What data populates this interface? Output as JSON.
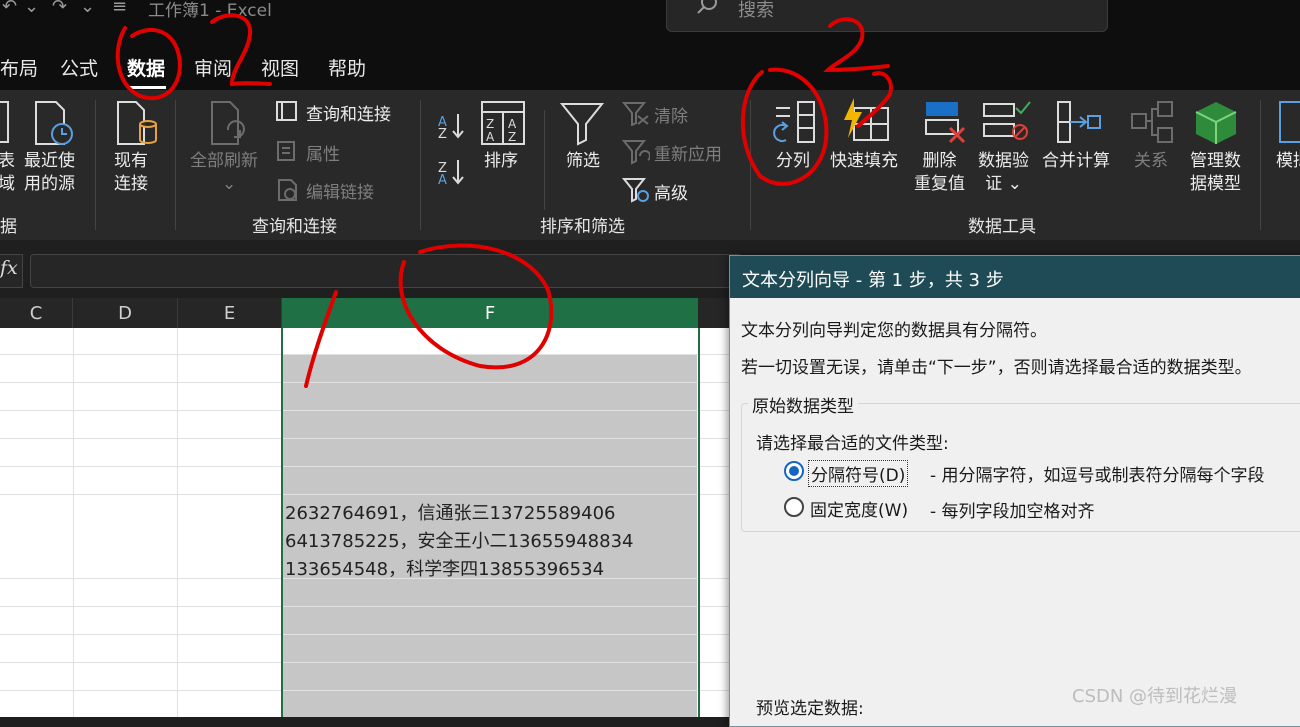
{
  "titlebar": {
    "qa_undo": "↶",
    "qa_chevron": "⌄",
    "qa_redo": "↷",
    "qa_customize": "≡",
    "doc_title": "工作簿1  -  Excel",
    "search_placeholder": "搜索"
  },
  "tabs": [
    "布局",
    "公式",
    "数据",
    "审阅",
    "视图",
    "帮助"
  ],
  "active_tab": "数据",
  "ribbon": {
    "get_data": {
      "from_table_partial": "表\n域",
      "recent_sources": "最近使\n用的源",
      "existing_connections": "现有\n连接",
      "group_label_partial": "据"
    },
    "queries": {
      "refresh_all": "全部刷新",
      "queries_connections": "查询和连接",
      "properties": "属性",
      "edit_links": "编辑链接",
      "group_label": "查询和连接"
    },
    "sort_filter": {
      "sort": "排序",
      "filter": "筛选",
      "clear": "清除",
      "reapply": "重新应用",
      "advanced": "高级",
      "group_label": "排序和筛选"
    },
    "data_tools": {
      "text_to_columns": "分列",
      "flash_fill": "快速填充",
      "remove_duplicates": "删除\n重复值",
      "data_validation": "数据验\n证 ⌄",
      "consolidate": "合并计算",
      "relationships": "关系",
      "manage_data_model": "管理数\n据模型",
      "group_label": "数据工具"
    },
    "forecast_partial": "模拟"
  },
  "formula_bar": {
    "fx": "fx",
    "value": ""
  },
  "grid": {
    "columns": [
      "C",
      "D",
      "E",
      "F"
    ],
    "selected_column": "F",
    "cells": [
      "2632764691，信通张三13725589406",
      "6413785225，安全王小二13655948834",
      "133654548，科学李四13855396534"
    ]
  },
  "dialog": {
    "title": "文本分列向导 - 第 1 步，共 3 步",
    "line1": "文本分列向导判定您的数据具有分隔符。",
    "line2": "若一切设置无误，请单击“下一步”，否则请选择最合适的数据类型。",
    "group_title": "原始数据类型",
    "choose_label": "请选择最合适的文件类型:",
    "option_delimited": "分隔符号(D)",
    "option_delimited_desc": "- 用分隔字符，如逗号或制表符分隔每个字段",
    "option_fixed": "固定宽度(W)",
    "option_fixed_desc": "- 每列字段加空格对齐",
    "selected_option": "delimited",
    "preview_label": "预览选定数据:"
  },
  "annotations": {
    "step1": "1",
    "step2a": "2",
    "step2b": "2",
    "color": "#e00000"
  },
  "watermark": "CSDN @待到花烂漫"
}
